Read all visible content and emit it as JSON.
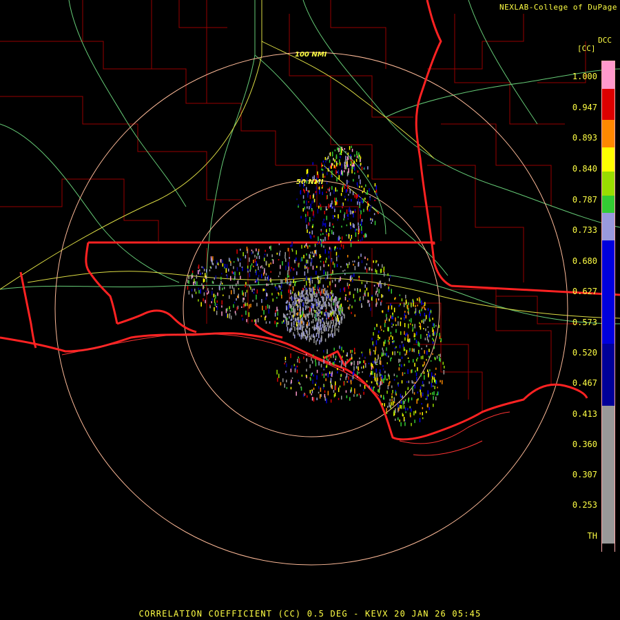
{
  "credit": "NEXLAB-College of DuPage",
  "colorbar": {
    "product": "DCC",
    "units": "[CC]",
    "labels": [
      "1.000",
      "0.947",
      "0.893",
      "0.840",
      "0.787",
      "0.733",
      "0.680",
      "0.627",
      "0.573",
      "0.520",
      "0.467",
      "0.413",
      "0.360",
      "0.307",
      "0.253",
      "TH"
    ],
    "colors": {
      "pink": "#ff99cc",
      "red": "#dd0000",
      "orange": "#ff8800",
      "yellow": "#ffff00",
      "lime": "#99dd00",
      "green": "#33cc33",
      "lavender": "#9999dd",
      "blue": "#0000dd",
      "navy": "#000099",
      "gray": "#999999"
    }
  },
  "range_rings": {
    "inner": "50 NMI",
    "outer": "100 NMI"
  },
  "footer": "CORRELATION COEFFICIENT (CC) 0.5 DEG - KEVX 20 JAN 26 05:45",
  "map_colors": {
    "county_lines": "#990000",
    "state_lines": "#ff2222",
    "highways_green": "#66cc77",
    "highways_yellow": "#dddd44",
    "range_ring": "#ffbb99"
  }
}
